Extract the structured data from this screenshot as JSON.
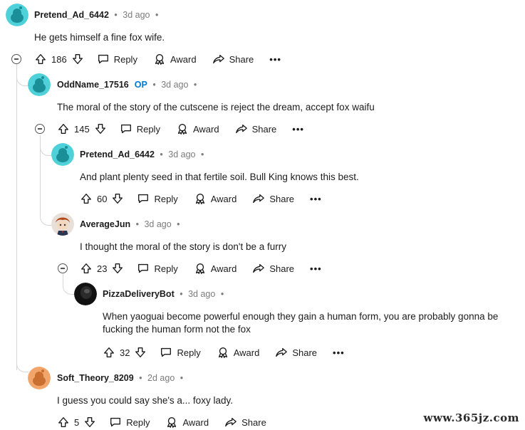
{
  "comments": [
    {
      "user": "Pretend_Ad_6442",
      "op": "",
      "time": "3d ago",
      "text": "He gets himself a fine fox wife.",
      "votes": "186",
      "avatar_color": "#4fd1d9"
    },
    {
      "user": "OddName_17516",
      "op": "OP",
      "time": "3d ago",
      "text": "The moral of the story of the cutscene is reject the dream, accept fox waifu",
      "votes": "145",
      "avatar_color": "#4fd1d9"
    },
    {
      "user": "Pretend_Ad_6442",
      "op": "",
      "time": "3d ago",
      "text": "And plant plenty seed in that fertile soil. Bull King knows this best.",
      "votes": "60",
      "avatar_color": "#4fd1d9"
    },
    {
      "user": "AverageJun",
      "op": "",
      "time": "3d ago",
      "text": "I thought the moral of the story is don't be a furry",
      "votes": "23",
      "avatar_color": "#e8e0d8"
    },
    {
      "user": "PizzaDeliveryBot",
      "op": "",
      "time": "3d ago",
      "text_line1": "When yaoguai become powerful enough they gain a human form, you are probably gonna be",
      "text_line2": "fucking the human form not the fox",
      "votes": "32",
      "avatar_color": "#111111"
    },
    {
      "user": "Soft_Theory_8209",
      "op": "",
      "time": "2d ago",
      "text": "I guess you could say she's a... foxy lady.",
      "votes": "5",
      "avatar_color": "#f2a56b"
    }
  ],
  "actions": {
    "reply": "Reply",
    "award": "Award",
    "share": "Share",
    "more": "•••",
    "dot": "•"
  },
  "watermark": "www.365jz.com"
}
